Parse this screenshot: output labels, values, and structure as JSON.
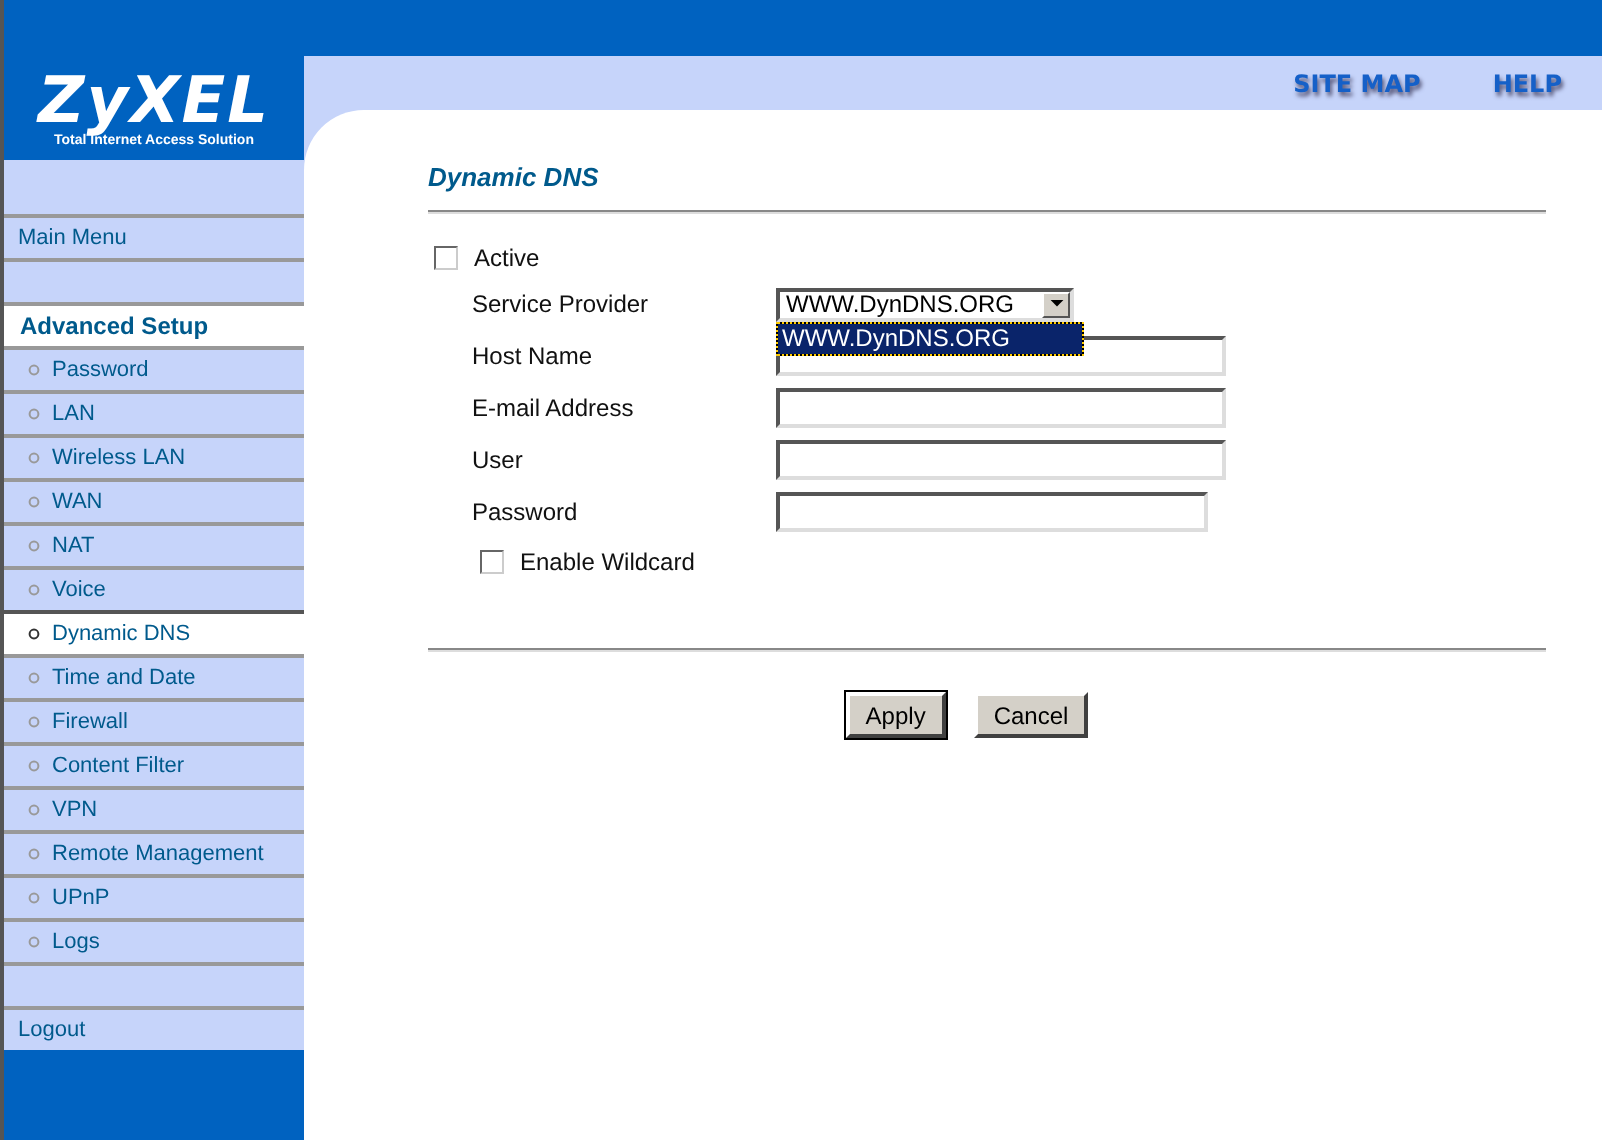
{
  "logo": {
    "brand": "ZyXEL",
    "tagline": "Total Internet Access Solution"
  },
  "header_links": [
    "SITE MAP",
    "HELP"
  ],
  "sidebar": {
    "main_menu": "Main Menu",
    "section": "Advanced Setup",
    "items": [
      {
        "label": "Password",
        "selected": false
      },
      {
        "label": "LAN",
        "selected": false
      },
      {
        "label": "Wireless LAN",
        "selected": false
      },
      {
        "label": "WAN",
        "selected": false
      },
      {
        "label": "NAT",
        "selected": false
      },
      {
        "label": "Voice",
        "selected": false
      },
      {
        "label": "Dynamic DNS",
        "selected": true
      },
      {
        "label": "Time and Date",
        "selected": false
      },
      {
        "label": "Firewall",
        "selected": false
      },
      {
        "label": "Content Filter",
        "selected": false
      },
      {
        "label": "VPN",
        "selected": false
      },
      {
        "label": "Remote Management",
        "selected": false
      },
      {
        "label": "UPnP",
        "selected": false
      },
      {
        "label": "Logs",
        "selected": false
      }
    ],
    "logout": "Logout"
  },
  "page_title": "Dynamic DNS",
  "active": {
    "label": "Active",
    "checked": false
  },
  "fields": [
    {
      "kind": "select",
      "label": "Service Provider",
      "value": "WWW.DynDNS.ORG",
      "options": [
        {
          "label": "WWW.DynDNS.ORG",
          "selected": true
        }
      ]
    },
    {
      "kind": "text",
      "label": "Host Name"
    },
    {
      "kind": "text",
      "label": "E-mail Address"
    },
    {
      "kind": "text",
      "label": "User"
    },
    {
      "kind": "password",
      "label": "Password"
    }
  ],
  "wildcard": {
    "label": "Enable Wildcard",
    "checked": false
  },
  "buttons": [
    {
      "label": "Apply",
      "focused": true
    },
    {
      "label": "Cancel",
      "focused": false
    }
  ]
}
